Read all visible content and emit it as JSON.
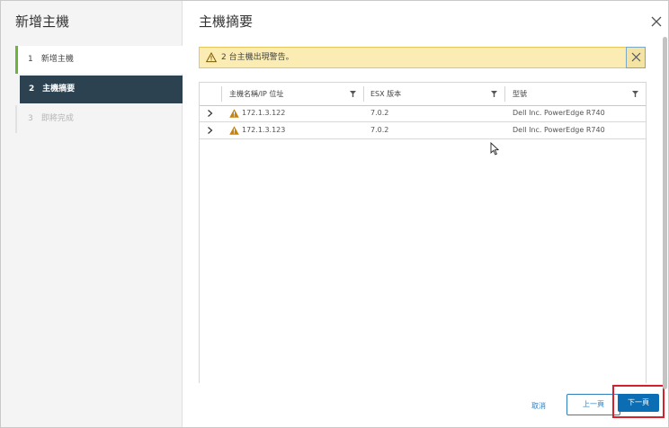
{
  "sidebar": {
    "title": "新增主機",
    "steps": [
      {
        "num": "1",
        "label": "新增主機"
      },
      {
        "num": "2",
        "label": "主機摘要"
      },
      {
        "num": "3",
        "label": "即將完成"
      }
    ]
  },
  "main": {
    "title": "主機摘要",
    "alert": {
      "text": "2 台主機出現警告。"
    },
    "grid": {
      "columns": [
        "主機名稱/IP 位址",
        "ESX 版本",
        "型號"
      ],
      "rows": [
        {
          "host": "172.1.3.122",
          "version": "7.0.2",
          "model": "Dell Inc. PowerEdge R740"
        },
        {
          "host": "172.1.3.123",
          "version": "7.0.2",
          "model": "Dell Inc. PowerEdge R740"
        }
      ]
    }
  },
  "footer": {
    "cancel": "取消",
    "previous": "上一頁",
    "next": "下一頁"
  },
  "colors": {
    "accent": "#0b6eb4",
    "sidebar_active": "#2d4250",
    "progress_done": "#6db33f",
    "warning_bg": "#faecb2",
    "highlight": "#d4212b"
  },
  "icons": [
    "warning-icon",
    "close-icon",
    "filter-icon",
    "chevron-right-icon",
    "mouse-cursor-icon"
  ]
}
